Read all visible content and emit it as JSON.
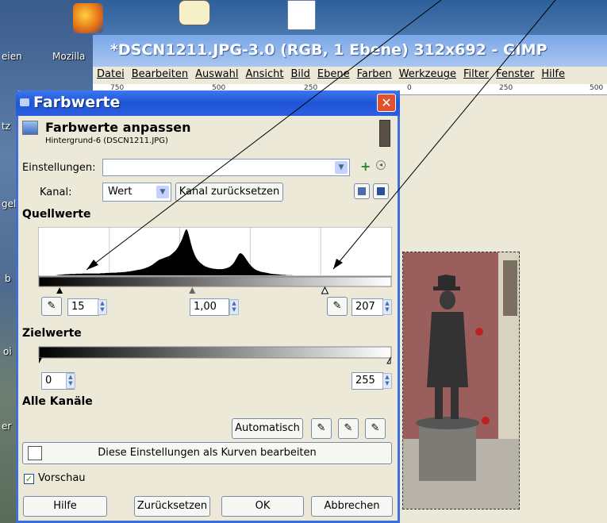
{
  "desktop": {
    "labels": [
      "eien",
      "Mozilla",
      "tz",
      "gel",
      "b",
      "oi",
      "er"
    ]
  },
  "gimp": {
    "title": "*DSCN1211.JPG-3.0 (RGB, 1 Ebene) 312x692 - GIMP",
    "menu": [
      "Datei",
      "Bearbeiten",
      "Auswahl",
      "Ansicht",
      "Bild",
      "Ebene",
      "Farben",
      "Werkzeuge",
      "Filter",
      "Fenster",
      "Hilfe"
    ],
    "ruler_ticks": [
      "750",
      "500",
      "250",
      "0",
      "250",
      "500"
    ]
  },
  "dialog": {
    "title": "Farbwerte",
    "header_title": "Farbwerte anpassen",
    "header_subtitle": "Hintergrund-6 (DSCN1211.JPG)",
    "settings_label": "Einstellungen:",
    "settings_value": "",
    "channel_label": "Kanal:",
    "channel_value": "Wert",
    "reset_channel_button": "Kanal zurücksetzen",
    "source_heading": "Quellwerte",
    "input_low": "15",
    "input_gamma": "1,00",
    "input_high": "207",
    "target_heading": "Zielwerte",
    "output_low": "0",
    "output_high": "255",
    "all_channels_heading": "Alle Kanäle",
    "auto_button": "Automatisch",
    "curves_button": "Diese Einstellungen als Kurven bearbeiten",
    "preview_label": "Vorschau",
    "preview_checked": true,
    "help_button": "Hilfe",
    "reset_button": "Zurücksetzen",
    "ok_button": "OK",
    "cancel_button": "Abbrechen"
  },
  "histogram": {
    "input_low": 15,
    "input_gamma": 1.0,
    "input_high": 207,
    "output_low": 0,
    "output_high": 255,
    "counts": [
      0,
      0,
      0,
      0,
      0,
      0,
      0,
      0,
      0,
      0,
      0,
      0,
      0,
      0,
      1,
      2,
      2,
      3,
      3,
      4,
      4,
      5,
      5,
      5,
      6,
      6,
      6,
      6,
      6,
      7,
      7,
      7,
      7,
      7,
      8,
      8,
      8,
      8,
      8,
      8,
      8,
      8,
      8,
      8,
      8,
      8,
      8,
      8,
      9,
      9,
      9,
      9,
      10,
      10,
      10,
      10,
      11,
      11,
      11,
      11,
      11,
      12,
      12,
      12,
      13,
      13,
      14,
      14,
      15,
      16,
      16,
      17,
      18,
      19,
      20,
      21,
      22,
      23,
      24,
      25,
      26,
      28,
      29,
      31,
      33,
      35,
      38,
      41,
      44,
      48,
      52,
      56,
      60,
      64,
      66,
      68,
      70,
      72,
      74,
      76,
      78,
      80,
      84,
      88,
      93,
      98,
      103,
      110,
      118,
      128,
      138,
      150,
      165,
      180,
      190,
      188,
      170,
      150,
      128,
      110,
      95,
      82,
      72,
      64,
      58,
      52,
      48,
      44,
      40,
      37,
      35,
      33,
      31,
      30,
      29,
      28,
      27,
      27,
      26,
      26,
      26,
      26,
      26,
      27,
      28,
      29,
      31,
      33,
      36,
      40,
      45,
      52,
      60,
      70,
      80,
      88,
      92,
      90,
      86,
      80,
      72,
      64,
      56,
      48,
      42,
      36,
      31,
      27,
      24,
      21,
      19,
      17,
      15,
      14,
      13,
      12,
      11,
      10,
      9,
      8,
      7,
      6,
      6,
      5,
      5,
      4,
      4,
      3,
      3,
      2,
      2,
      2,
      1,
      1,
      1,
      1,
      1,
      0,
      0,
      0,
      0,
      0,
      0,
      0,
      0,
      0,
      0,
      0,
      0,
      0,
      0,
      0,
      0,
      0,
      0,
      0,
      0,
      0,
      0,
      0,
      0,
      0,
      0,
      0,
      0,
      0,
      0,
      0,
      0,
      0,
      0,
      0,
      0,
      0,
      0,
      0,
      0,
      0,
      0,
      0,
      0,
      0,
      0,
      0,
      0,
      0,
      0,
      0,
      0,
      0,
      0,
      0,
      0,
      0,
      0,
      0,
      0,
      0,
      0,
      0,
      0,
      0,
      0,
      0,
      0,
      0,
      0,
      0,
      0,
      0,
      0,
      0,
      0,
      0
    ]
  },
  "colors": {
    "dialog_title_bar": "#2a5fe0",
    "gimp_title_bar": "#7aa7e8",
    "close_button": "#e0512f",
    "dialog_background": "#ece9d8"
  }
}
